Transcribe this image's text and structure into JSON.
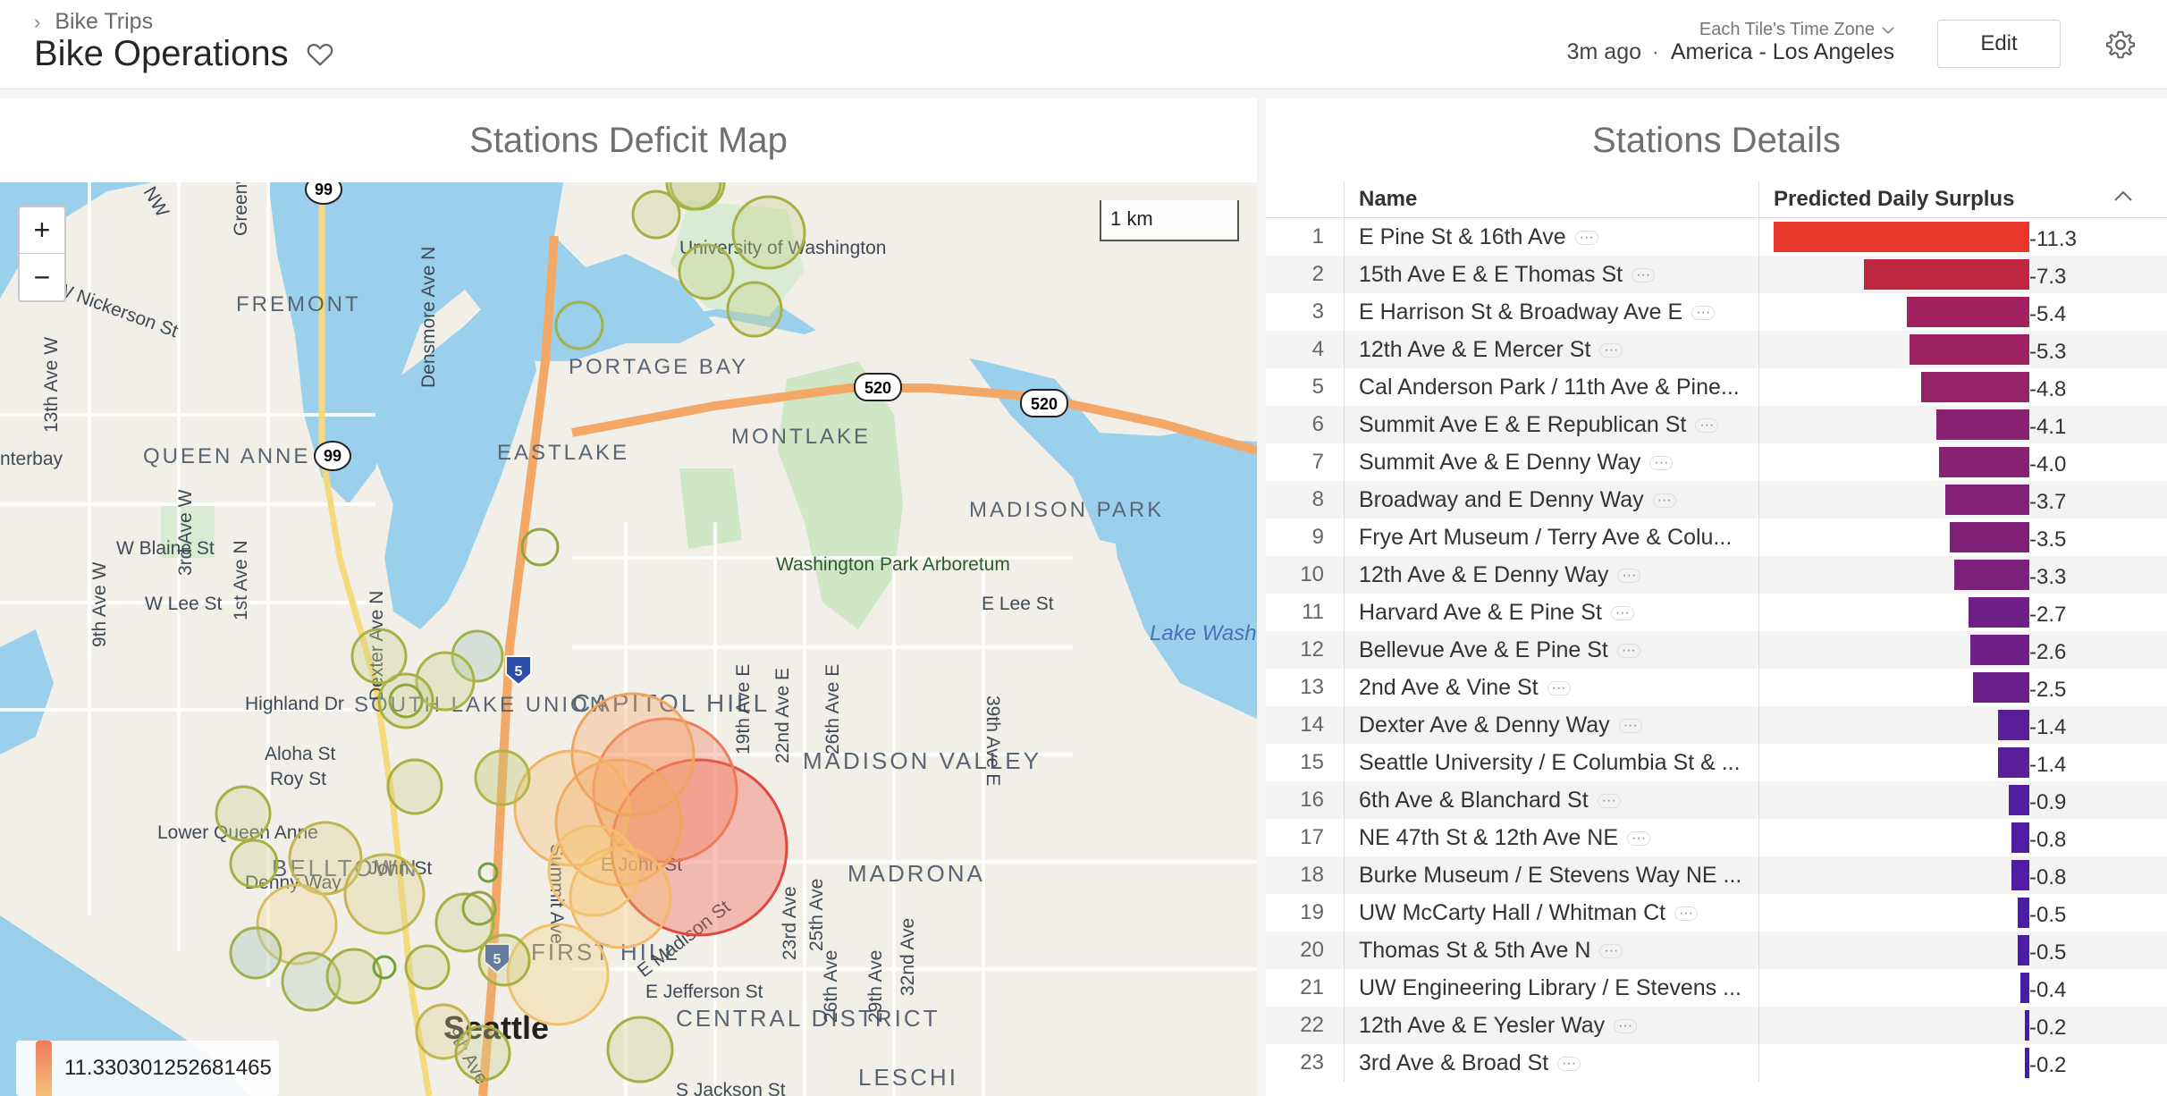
{
  "header": {
    "breadcrumb": "Bike Trips",
    "title": "Bike Operations",
    "updated": "3m ago",
    "separator": "·",
    "tz_label": "Each Tile's Time Zone",
    "tz_value": "America - Los Angeles",
    "edit_label": "Edit"
  },
  "map_panel": {
    "title": "Stations Deficit Map",
    "zoom_in": "+",
    "zoom_out": "−",
    "scale_label": "1 km",
    "legend_value": "11.330301252681465",
    "labels": {
      "fremont": "FREMONT",
      "queen_anne": "QUEEN ANNE",
      "portage_bay": "PORTAGE BAY",
      "eastlake": "EASTLAKE",
      "montlake": "MONTLAKE",
      "madison_park": "MADISON PARK",
      "uw": "University of Washington",
      "arboretum": "Washington Park Arboretum",
      "lake_wash": "Lake Washi",
      "south_lake_union": "SOUTH LAKE UNION",
      "capitol_hill": "CAPITOL HILL",
      "madison_valley": "MADISON VALLEY",
      "madrona": "MADRONA",
      "belltown": "BELLTOWN",
      "first_hill": "FIRST HILL",
      "central_district": "CENTRAL DISTRICT",
      "leschi": "LESCHI",
      "seattle": "Seattle",
      "w_nickerson": "W Nickerson St",
      "w_blaine": "W Blaine St",
      "w_lee": "W Lee St",
      "highland": "Highland Dr",
      "aloha": "Aloha St",
      "roy": "Roy St",
      "lower_queen_anne": "Lower Queen Anne",
      "denny_way": "Denny Way",
      "john_st": "John St",
      "e_john": "E John St",
      "e_madison": "E Madison St",
      "e_jefferson": "E Jefferson St",
      "e_lee": "E Lee St",
      "dexter": "Dexter Ave N",
      "summit": "Summit Ave",
      "ave19": "19th Ave E",
      "ave22": "22nd Ave E",
      "ave26": "26th Ave E",
      "ave39": "39th Ave E",
      "ave23": "23rd Ave",
      "ave25": "25th Ave",
      "ave29": "29th Ave",
      "ave32": "32nd Ave",
      "ave26s": "26th Ave",
      "ave3w": "3rd Ave W",
      "ave9w": "9th Ave W",
      "ave1n": "1st Ave N",
      "ave13w": "13th Ave W",
      "ave9": "9th Ave",
      "nw": "NW",
      "greenw": "Greenw",
      "densmore": "Densmore Ave N",
      "terbay": "nterbay",
      "h99a": "99",
      "h99b": "99",
      "h520a": "520",
      "h520b": "520",
      "i5a": "5",
      "i5b": "5",
      "jackson": "S Jackson St"
    }
  },
  "details_panel": {
    "title": "Stations Details",
    "col_name": "Name",
    "col_value": "Predicted Daily Surplus",
    "more": "···",
    "rows": [
      {
        "idx": "1",
        "name": "E Pine St & 16th Ave",
        "value": -11.3,
        "label": "-11.3",
        "color": "#e8362a"
      },
      {
        "idx": "2",
        "name": "15th Ave E & E Thomas St",
        "value": -7.3,
        "label": "-7.3",
        "color": "#bf2640"
      },
      {
        "idx": "3",
        "name": "E Harrison St & Broadway Ave E",
        "value": -5.4,
        "label": "-5.4",
        "color": "#a02260"
      },
      {
        "idx": "4",
        "name": "12th Ave & E Mercer St",
        "value": -5.3,
        "label": "-5.3",
        "color": "#9e2262"
      },
      {
        "idx": "5",
        "name": "Cal Anderson Park / 11th Ave & Pine...",
        "value": -4.8,
        "label": "-4.8",
        "color": "#962268"
      },
      {
        "idx": "6",
        "name": "Summit Ave E & E Republican St",
        "value": -4.1,
        "label": "-4.1",
        "color": "#8a2170"
      },
      {
        "idx": "7",
        "name": "Summit Ave & E Denny Way",
        "value": -4.0,
        "label": "-4.0",
        "color": "#872172"
      },
      {
        "idx": "8",
        "name": "Broadway and E Denny Way",
        "value": -3.7,
        "label": "-3.7",
        "color": "#832176"
      },
      {
        "idx": "9",
        "name": "Frye Art Museum / Terry Ave & Colu...",
        "value": -3.5,
        "label": "-3.5",
        "color": "#7f2078"
      },
      {
        "idx": "10",
        "name": "12th Ave & E Denny Way",
        "value": -3.3,
        "label": "-3.3",
        "color": "#7c207c"
      },
      {
        "idx": "11",
        "name": "Harvard Ave & E Pine St",
        "value": -2.7,
        "label": "-2.7",
        "color": "#701f86"
      },
      {
        "idx": "12",
        "name": "Bellevue Ave & E Pine St",
        "value": -2.6,
        "label": "-2.6",
        "color": "#6e1f88"
      },
      {
        "idx": "13",
        "name": "2nd Ave & Vine St",
        "value": -2.5,
        "label": "-2.5",
        "color": "#6c1f8a"
      },
      {
        "idx": "14",
        "name": "Dexter Ave & Denny Way",
        "value": -1.4,
        "label": "-1.4",
        "color": "#5a1e98"
      },
      {
        "idx": "15",
        "name": "Seattle University / E Columbia St & ...",
        "value": -1.4,
        "label": "-1.4",
        "color": "#5a1e98"
      },
      {
        "idx": "16",
        "name": "6th Ave & Blanchard St",
        "value": -0.9,
        "label": "-0.9",
        "color": "#521da0"
      },
      {
        "idx": "17",
        "name": "NE 47th St & 12th Ave NE",
        "value": -0.8,
        "label": "-0.8",
        "color": "#501da2"
      },
      {
        "idx": "18",
        "name": "Burke Museum / E Stevens Way NE ...",
        "value": -0.8,
        "label": "-0.8",
        "color": "#501da2"
      },
      {
        "idx": "19",
        "name": "UW McCarty Hall / Whitman Ct",
        "value": -0.5,
        "label": "-0.5",
        "color": "#4b1da6"
      },
      {
        "idx": "20",
        "name": "Thomas St & 5th Ave N",
        "value": -0.5,
        "label": "-0.5",
        "color": "#4b1da6"
      },
      {
        "idx": "21",
        "name": "UW Engineering Library / E Stevens ...",
        "value": -0.4,
        "label": "-0.4",
        "color": "#491ca8"
      },
      {
        "idx": "22",
        "name": "12th Ave & E Yesler Way",
        "value": -0.2,
        "label": "-0.2",
        "color": "#461caa"
      },
      {
        "idx": "23",
        "name": "3rd Ave & Broad St",
        "value": -0.2,
        "label": "-0.2",
        "color": "#461caa"
      }
    ]
  }
}
